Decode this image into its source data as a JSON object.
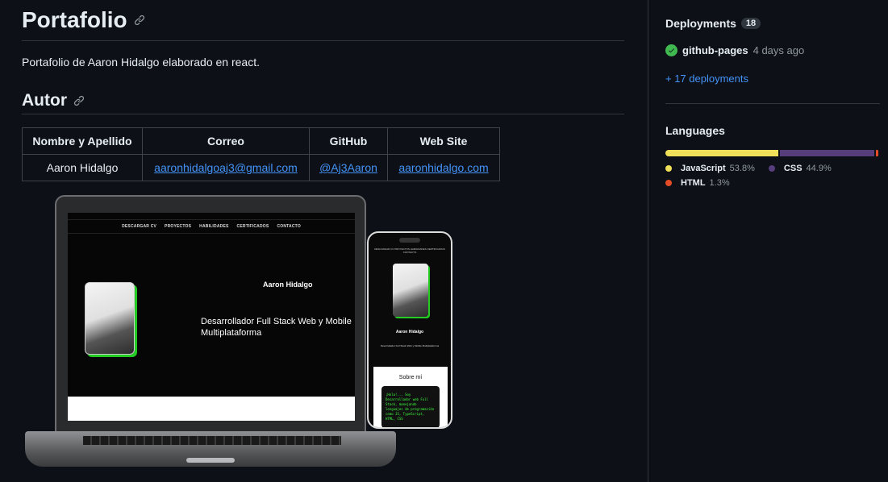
{
  "readme": {
    "title": "Portafolio",
    "description": "Portafolio de Aaron Hidalgo elaborado en react.",
    "section_title": "Autor",
    "table": {
      "headers": [
        "Nombre y Apellido",
        "Correo",
        "GitHub",
        "Web Site"
      ],
      "row": [
        "Aaron Hidalgo",
        "aaronhidalgoaj3@gmail.com",
        "@Aj3Aaron",
        "aaronhidalgo.com"
      ]
    },
    "mockup": {
      "nav_items": [
        "DESCARGAR CV",
        "PROYECTOS",
        "HABILIDADES",
        "CERTIFICADOS",
        "CONTACTO"
      ],
      "name": "Aaron Hidalgo",
      "role": "Desarrollador Full Stack Web y Mobile Multiplataforma",
      "phone_role": "Desarrollador Full Stack Web y Mobile Multiplataforma",
      "sobre": "Sobre mí",
      "code": "¡Hola!... Soy Desarrollador web Full Stack, manejando lenguajes de programación como JS, TypeScript, HTML, CSS"
    }
  },
  "sidebar": {
    "deployments": {
      "title": "Deployments",
      "count": "18",
      "env": "github-pages",
      "time": "4 days ago",
      "more": "+ 17 deployments",
      "status_color": "#3fb950"
    },
    "languages": {
      "title": "Languages",
      "items": [
        {
          "name": "JavaScript",
          "pct": "53.8%",
          "value": 53.8,
          "color": "#f1e05a"
        },
        {
          "name": "CSS",
          "pct": "44.9%",
          "value": 44.9,
          "color": "#563d7c"
        },
        {
          "name": "HTML",
          "pct": "1.3%",
          "value": 1.3,
          "color": "#e34c26"
        }
      ]
    }
  }
}
